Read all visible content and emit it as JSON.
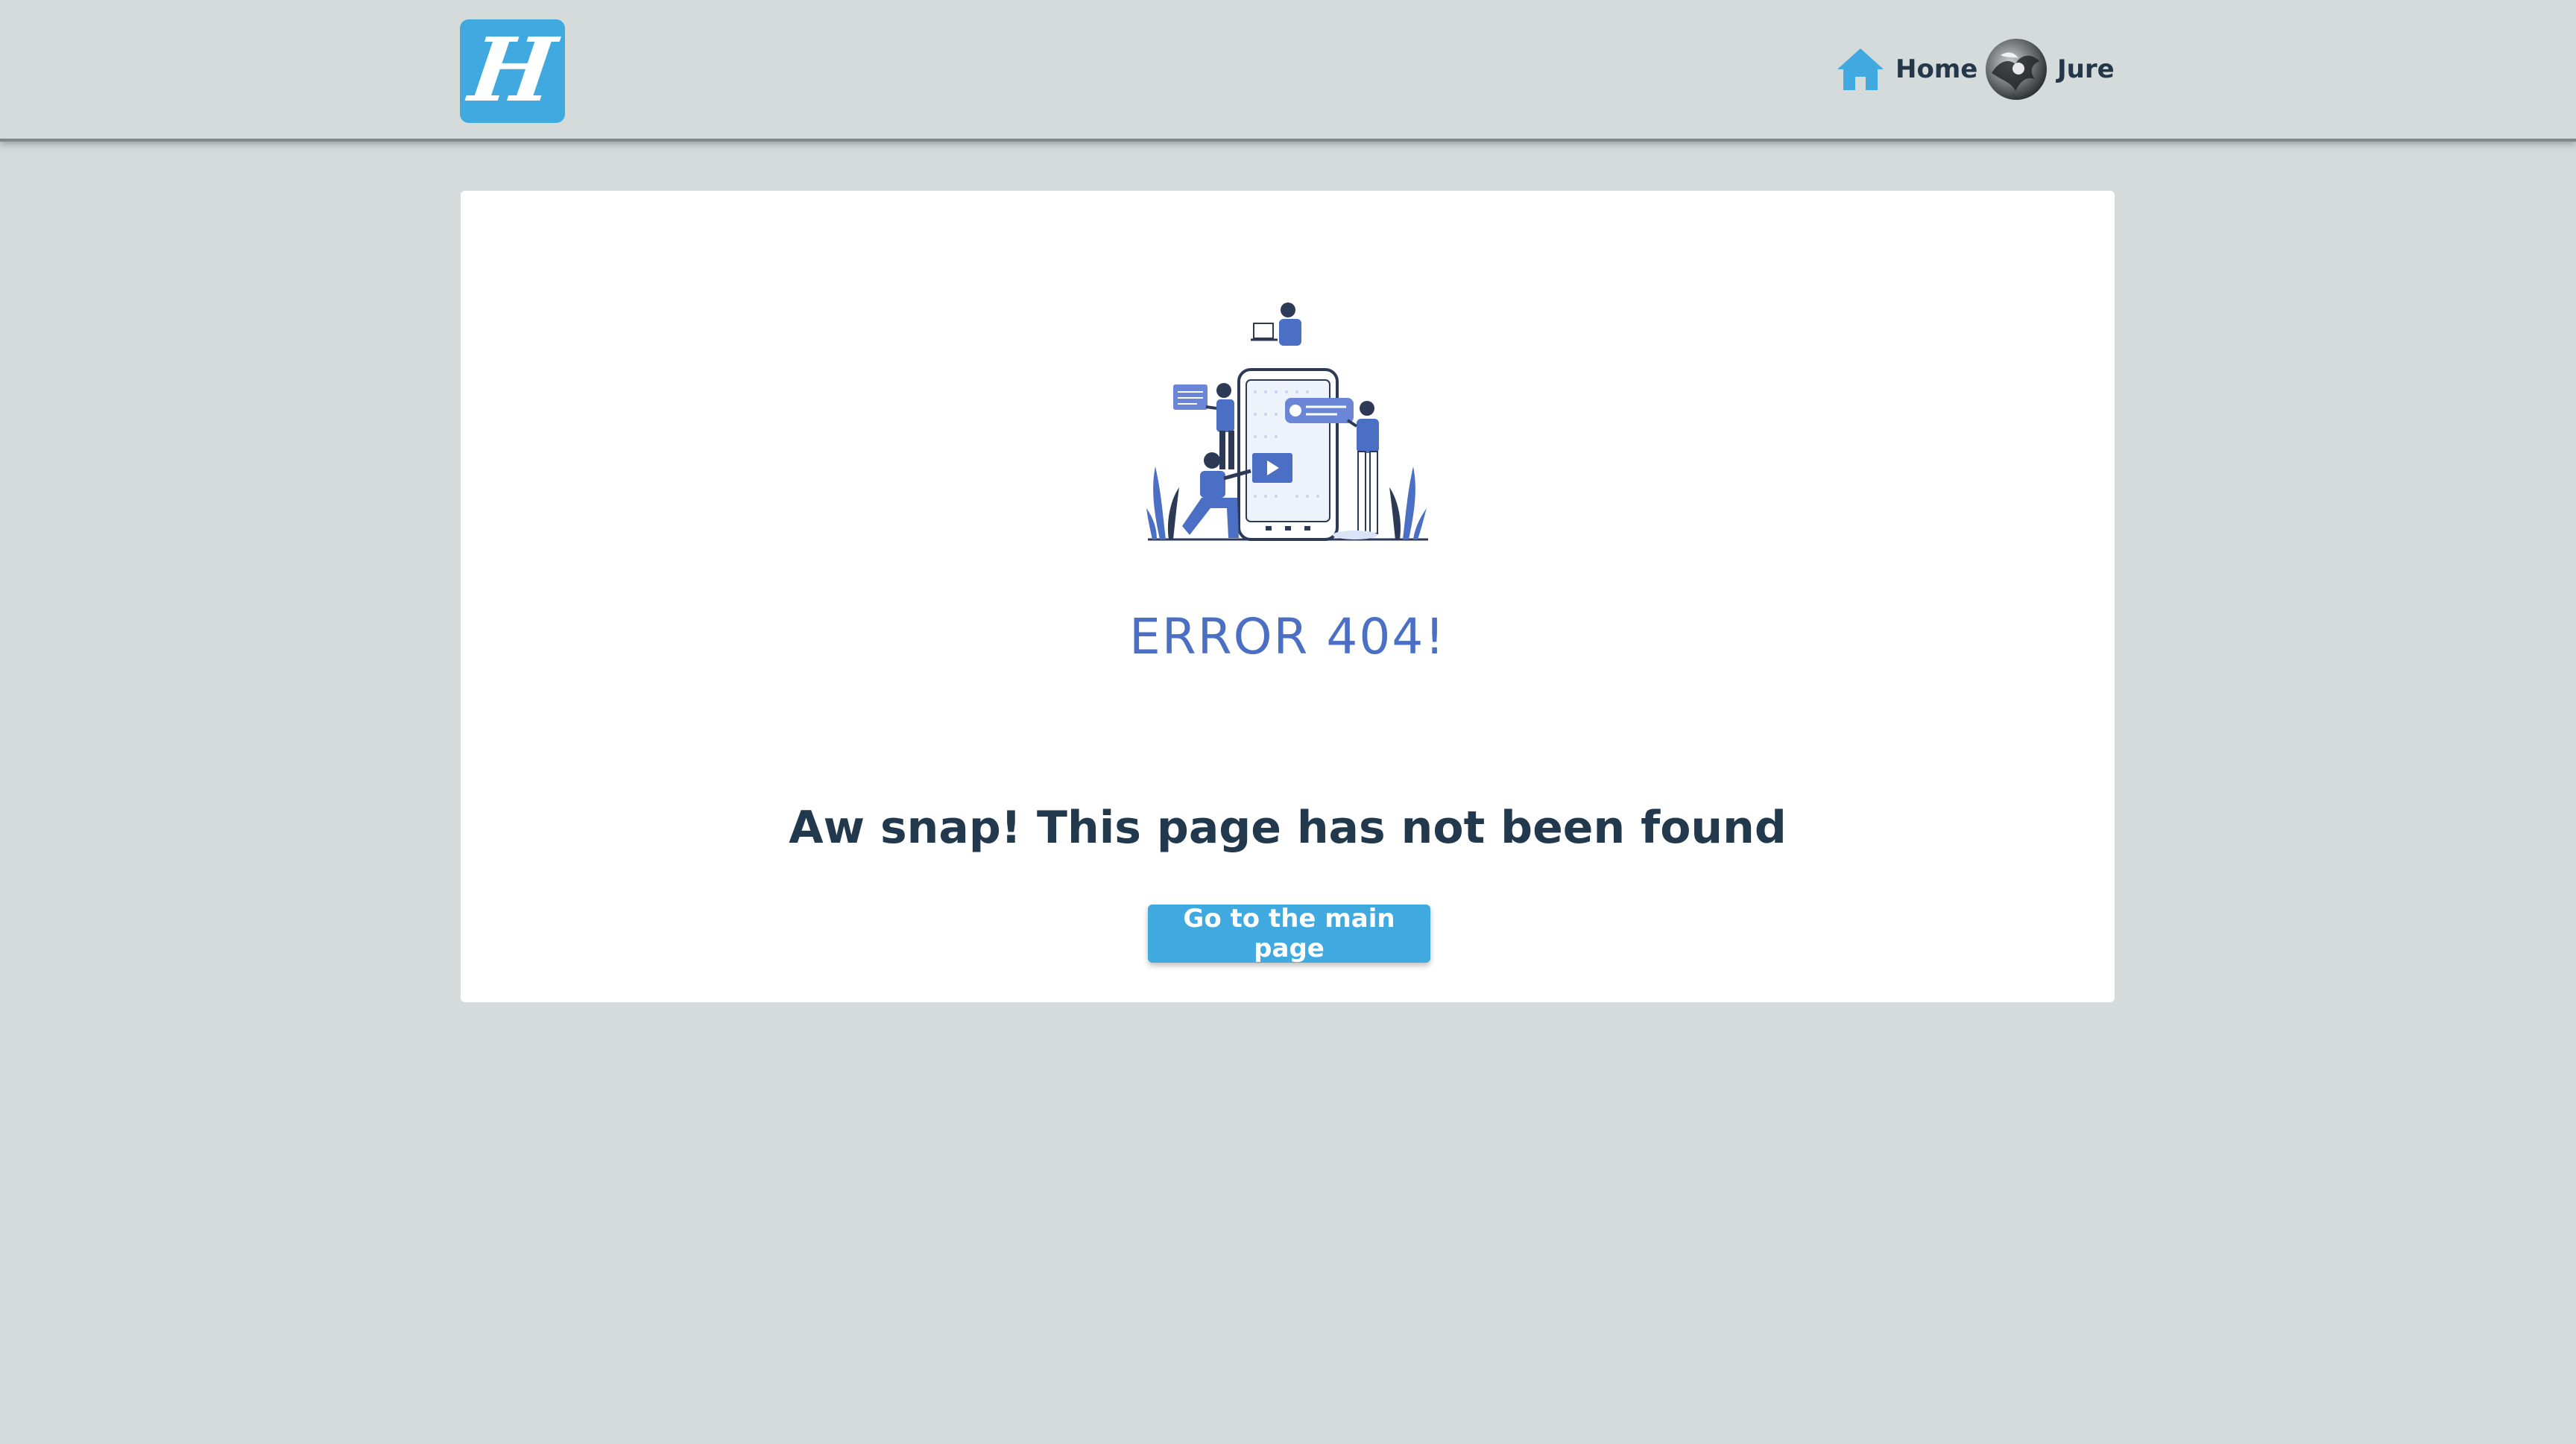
{
  "header": {
    "logo_letter": "H",
    "nav": {
      "home_label": "Home",
      "user_label": "Jure"
    }
  },
  "main": {
    "error_title": "ERROR 404!",
    "message": "Aw snap! This page has not been found",
    "button_label": "Go to the main page"
  },
  "icons": {
    "home": "home-icon",
    "avatar": "user-avatar",
    "illustration": "404-people-phone-illustration"
  },
  "colors": {
    "background": "#d5dada",
    "accent": "#3fa9e0",
    "error_title": "#4a6fc4",
    "text": "#22384c",
    "card": "#ffffff"
  }
}
